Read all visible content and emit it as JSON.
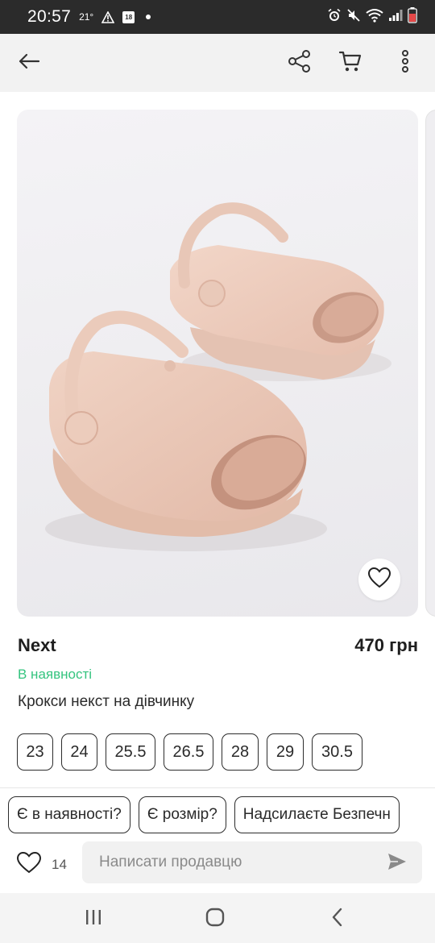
{
  "status_bar": {
    "time": "20:57",
    "temperature": "21°",
    "calendar_day": "18",
    "icons": [
      "warning-icon",
      "calendar-icon",
      "dot-icon",
      "alarm-icon",
      "mute-icon",
      "wifi-icon",
      "signal-icon",
      "battery-icon"
    ]
  },
  "toolbar": {
    "icons": [
      "back-arrow-icon",
      "share-icon",
      "cart-icon",
      "more-vertical-icon"
    ]
  },
  "product": {
    "image_subject": "pink children's crocs sandals",
    "brand": "Next",
    "price": "470 грн",
    "availability": "В наявності",
    "title": "Крокси некст на дівчинку",
    "sizes": [
      "23",
      "24",
      "25.5",
      "26.5",
      "28",
      "29",
      "30.5"
    ]
  },
  "quick_replies": [
    "Є в наявності?",
    "Є розмір?",
    "Надсилаєте Безпечн"
  ],
  "bottom": {
    "like_count": "14",
    "message_placeholder": "Написати продавцю"
  },
  "colors": {
    "availability_green": "#35c47f",
    "status_bar_bg": "#2b2b2b",
    "app_bar_bg": "#f2f2f2",
    "sandal_pink": "#efd0c1"
  }
}
